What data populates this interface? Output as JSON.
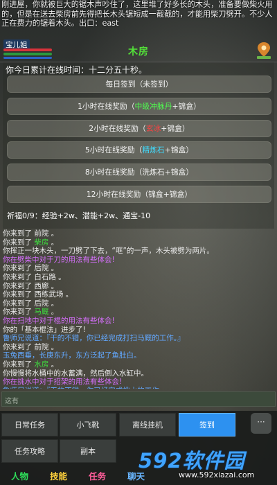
{
  "story": "刚进屋，你就被巨大的锯木声吵住了，这里堆了好多长的木头，准备要做柴火用的，但是在送去柴房前先得把长木头锯短成一截截的，才能用柴刀劈开。不少人正在费力的锯着木头。出口：east",
  "character": {
    "name": "宝儿姐"
  },
  "location_title": "木房",
  "online_time": "你今日累计在线时间：十二分五十秒。",
  "rewards": [
    {
      "parts": [
        {
          "text": "每日签到（未签到）",
          "cls": ""
        }
      ]
    },
    {
      "parts": [
        {
          "text": "1小时在线奖励（",
          "cls": ""
        },
        {
          "text": "中级冲脉丹",
          "cls": "green"
        },
        {
          "text": "+锦盒）",
          "cls": ""
        }
      ]
    },
    {
      "parts": [
        {
          "text": "2小时在线奖励（",
          "cls": ""
        },
        {
          "text": "玄冰",
          "cls": "red"
        },
        {
          "text": "+锦盒）",
          "cls": ""
        }
      ]
    },
    {
      "parts": [
        {
          "text": "5小时在线奖励（",
          "cls": ""
        },
        {
          "text": "精炼石",
          "cls": "cyan"
        },
        {
          "text": "+锦盒）",
          "cls": ""
        }
      ]
    },
    {
      "parts": [
        {
          "text": "8小时在线奖励（洗炼石+锦盒）",
          "cls": ""
        }
      ]
    },
    {
      "parts": [
        {
          "text": "12小时在线奖励（锦盒+锦盒）",
          "cls": ""
        }
      ]
    }
  ],
  "bonus_line": "祈福0/9：经验+2w、潜能+2w、通宝-10",
  "log": [
    {
      "text": "你来到了 前院 。",
      "type": "plain"
    },
    {
      "pre": "你来到了 ",
      "loc": "柴房",
      "post": " 。",
      "type": "loc"
    },
    {
      "text": "你挥正一块木头，一刀劈了下去，“哐”的一声，木头被劈为两片。",
      "type": "plain"
    },
    {
      "text": "你在劈柴中对于刀的用法有些体会!",
      "type": "purple"
    },
    {
      "text": "你来到了 后院 。",
      "type": "plain"
    },
    {
      "text": "你来到了 白石路 。",
      "type": "plain"
    },
    {
      "text": "你来到了 西廊 。",
      "type": "plain"
    },
    {
      "text": "你来到了 西练武场 。",
      "type": "plain"
    },
    {
      "text": "你来到了 后院 。",
      "type": "plain"
    },
    {
      "pre": "你来到了 ",
      "loc": "马厩",
      "post": " 。",
      "type": "loc"
    },
    {
      "text": "你在扫地中对于棍的用法有些体会!",
      "type": "purple"
    },
    {
      "text": "你的「基本棍法」进步了!",
      "type": "plain"
    },
    {
      "text": "鲁师兄说道：『干的不错，你已经完成打扫马厩的工作。』",
      "type": "blue"
    },
    {
      "text": "你来到了 前院 。",
      "type": "plain"
    },
    {
      "text": "玉兔西垂，长庚东升，东方泛起了鱼肚白。",
      "type": "blue"
    },
    {
      "pre": "你来到了 ",
      "loc": "水房",
      "post": " 。",
      "type": "loc"
    },
    {
      "text": "你慢慢将水桶中的水蓄满，然后倒入水缸中。",
      "type": "plain"
    },
    {
      "text": "你在挑水中对于招架的用法有些体会!",
      "type": "purple"
    },
    {
      "text": "鲁师兄说道：『干的不错，你已经完成挑水的工作。』",
      "type": "blue"
    },
    {
      "text": "你来到了 前院",
      "type": "plain"
    },
    {
      "pre": "你来到了 ",
      "loc": "木房",
      "post": "",
      "type": "loc"
    },
    {
      "text": "你在锯木头的推拉中对基本手法有些体会!",
      "type": "purple"
    },
    {
      "text": "鲁师兄说道：『干的不错，你已经完成锯木头的工作。』",
      "type": "blue"
    }
  ],
  "input_placeholder": "这有",
  "commands": [
    {
      "label": "日常任务",
      "active": false
    },
    {
      "label": "小飞靴",
      "active": false
    },
    {
      "label": "离线挂机",
      "active": false
    },
    {
      "label": "签到",
      "active": true
    },
    {
      "label": "任务攻略",
      "active": false
    },
    {
      "label": "副本",
      "active": false
    }
  ],
  "more_label": "···",
  "tabs": [
    "人物",
    "技能",
    "任务",
    "聊天"
  ],
  "watermark": {
    "brand": "592软件园",
    "url": "www.592xiazai.com"
  },
  "colors": {
    "title_green": "#53e039",
    "active_blue": "#2d91f0",
    "location_green": "#3fdc3f"
  }
}
